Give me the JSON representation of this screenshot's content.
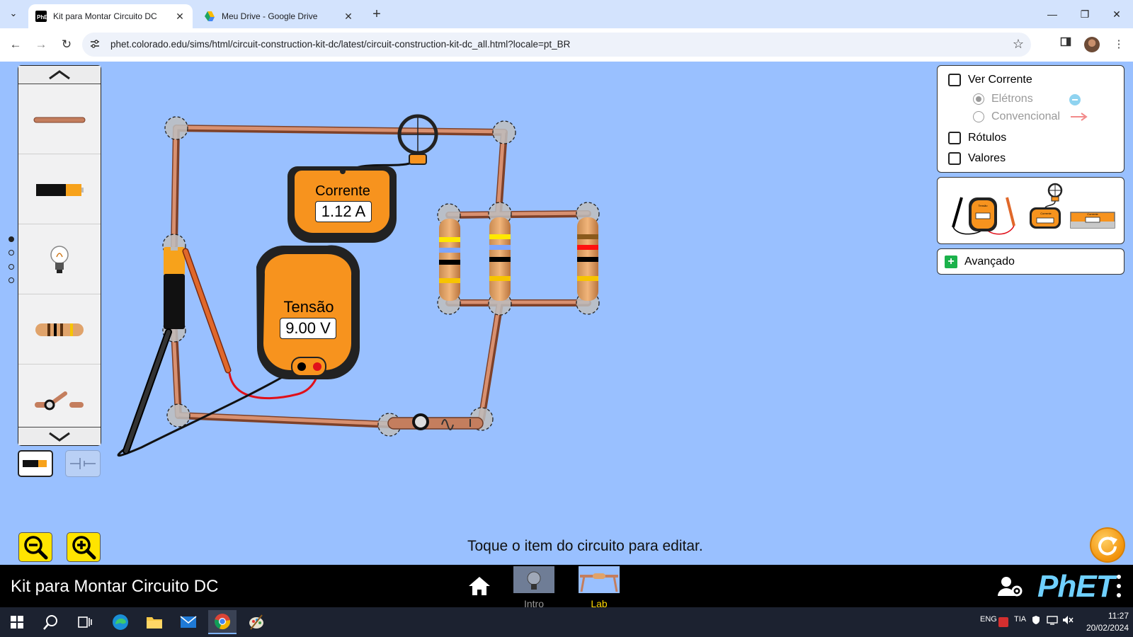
{
  "browser": {
    "tabs": [
      {
        "title": "Kit para Montar Circuito DC",
        "close": "✕"
      },
      {
        "title": "Meu Drive - Google Drive",
        "close": "✕"
      }
    ],
    "tab_search_icon": "chevron-down-icon",
    "new_tab": "+",
    "window_controls": {
      "minimize": "—",
      "restore": "❐",
      "close": "✕"
    },
    "nav": {
      "back": "←",
      "forward": "→",
      "reload": "↻"
    },
    "url": "phet.colorado.edu/sims/html/circuit-construction-kit-dc/latest/circuit-construction-kit-dc_all.html?locale=pt_BR",
    "bookmark_icon": "☆"
  },
  "sim": {
    "current_meter": {
      "title": "Corrente",
      "value": "1.12 A"
    },
    "voltmeter": {
      "title": "Tensão",
      "value": "9.00 V"
    },
    "options": {
      "show_current": "Ver Corrente",
      "electrons": "Elétrons",
      "conventional": "Convencional",
      "labels": "Rótulos",
      "values": "Valores"
    },
    "sensor_tool_labels": {
      "voltmeter": "Tensão",
      "ammeter": "Corrente",
      "series_ammeter": "Corrente"
    },
    "advanced": "Avançado",
    "status_message": "Toque o item do circuito para editar.",
    "palette_items": [
      "wire",
      "battery",
      "light-bulb",
      "resistor",
      "switch"
    ],
    "colors": {
      "background": "#99c0ff",
      "wire": "#c47e5e",
      "meter_orange": "#f7931e"
    }
  },
  "navbar": {
    "title": "Kit para Montar Circuito DC",
    "screens": [
      {
        "label": "Intro"
      },
      {
        "label": "Lab"
      }
    ],
    "logo": "PhET"
  },
  "taskbar": {
    "tray": {
      "lang": "ENG",
      "tia": "TIA"
    },
    "time": "11:27",
    "date": "20/02/2024"
  }
}
